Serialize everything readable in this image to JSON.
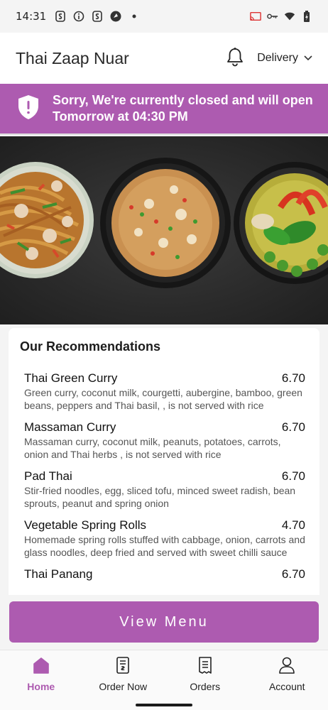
{
  "status_bar": {
    "time": "14:31",
    "left_icons": [
      "s-app-icon",
      "info-icon",
      "s-app-icon",
      "circle-app-icon",
      "dot-icon"
    ],
    "right_icons": [
      "cast-icon",
      "key-icon",
      "wifi-icon",
      "battery-icon"
    ]
  },
  "header": {
    "store_name": "Thai Zaap Nuar",
    "notification_icon": "bell-icon",
    "order_mode": "Delivery"
  },
  "banner": {
    "icon": "shield-alert-icon",
    "message": "Sorry, We're currently closed and will open Tomorrow at 04:30 PM",
    "background": "#ad5bb0"
  },
  "hero": {
    "image": "three dishes of thai food"
  },
  "recommendations": {
    "title": "Our Recommendations",
    "items": [
      {
        "name": "Thai Green Curry",
        "price": "6.70",
        "description": "Green curry, coconut milk, courgetti, aubergine, bamboo, green beans, peppers and Thai basil, , is not served with rice"
      },
      {
        "name": "Massaman Curry",
        "price": "6.70",
        "description": "Massaman curry, coconut milk, peanuts, potatoes, carrots, onion and Thai herbs , is not served with rice"
      },
      {
        "name": "Pad Thai",
        "price": "6.70",
        "description": "Stir-fried noodles, egg, sliced tofu, minced sweet radish, bean sprouts, peanut and spring onion"
      },
      {
        "name": "Vegetable Spring Rolls",
        "price": "4.70",
        "description": "Homemade spring rolls stuffed with cabbage, onion, carrots and glass noodles, deep fried and served with sweet chilli sauce"
      },
      {
        "name": "Thai Panang",
        "price": "6.70",
        "description": ""
      }
    ]
  },
  "view_menu_label": "View Menu",
  "bottom_nav": {
    "items": [
      {
        "label": "Home",
        "icon": "home-icon",
        "active": true
      },
      {
        "label": "Order Now",
        "icon": "order-receipt-icon",
        "active": false
      },
      {
        "label": "Orders",
        "icon": "orders-list-icon",
        "active": false
      },
      {
        "label": "Account",
        "icon": "user-icon",
        "active": false
      }
    ]
  },
  "colors": {
    "accent": "#ad5bb0",
    "background": "#f4f4f4"
  }
}
